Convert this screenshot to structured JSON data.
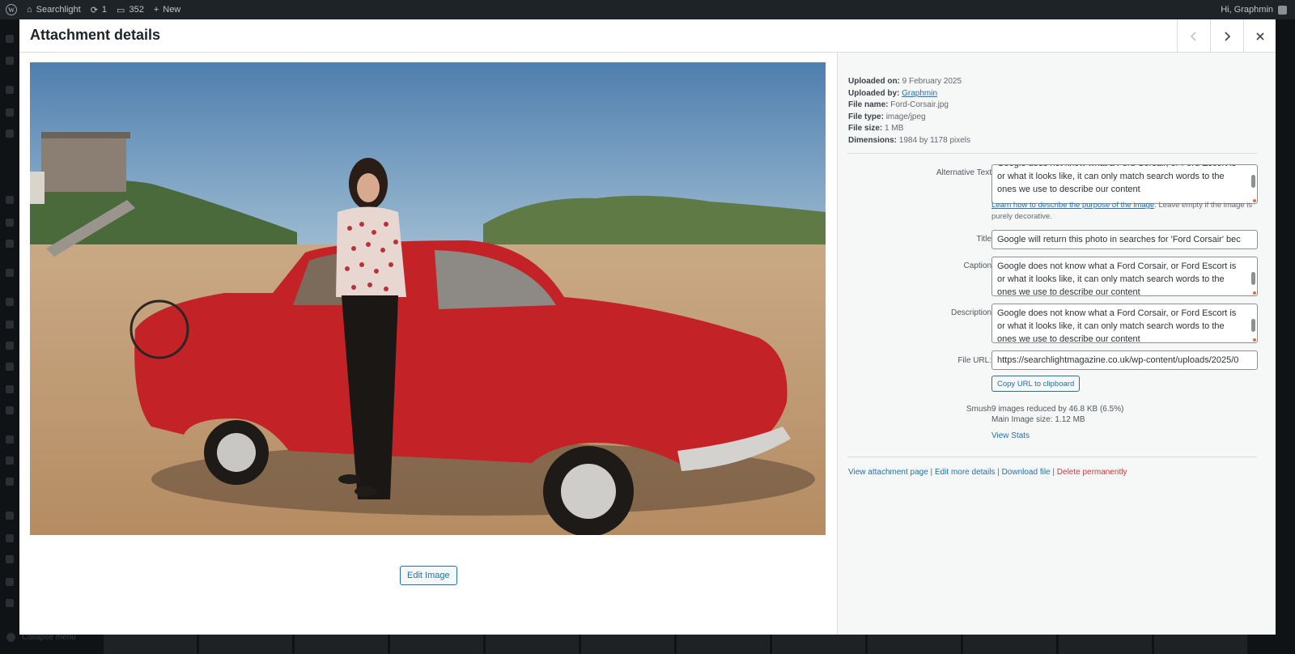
{
  "adminbar": {
    "site_name": "Searchlight",
    "updates": "1",
    "comments": "352",
    "new_label": "New",
    "greeting": "Hi, Graphmin"
  },
  "sidebar_menu": {
    "collapse_label": "Collapse menu"
  },
  "modal": {
    "title": "Attachment details",
    "edit_image_label": "Edit Image"
  },
  "details": {
    "uploaded_on_label": "Uploaded on:",
    "uploaded_on": "9 February 2025",
    "uploaded_by_label": "Uploaded by:",
    "uploaded_by": "Graphmin",
    "file_name_label": "File name:",
    "file_name": "Ford-Corsair.jpg",
    "file_type_label": "File type:",
    "file_type": "image/jpeg",
    "file_size_label": "File size:",
    "file_size": "1 MB",
    "dimensions_label": "Dimensions:",
    "dimensions": "1984 by 1178 pixels"
  },
  "fields": {
    "alt_label": "Alternative Text",
    "alt_value": "Google does not know what a Ford Corsair, or Ford Escort is or what it looks like, it can only match search words to the ones we use to describe our content",
    "alt_help_link": "Learn how to describe the purpose of the image",
    "alt_help_text": ". Leave empty if the image is purely decorative.",
    "title_label": "Title",
    "title_value": "Google will return this photo in searches for 'Ford Corsair' bec",
    "caption_label": "Caption",
    "caption_value": "Google does not know what a Ford Corsair, or Ford Escort is or what it looks like, it can only match search words to the ones we use to describe our content",
    "description_label": "Description",
    "description_value": "Google does not know what a Ford Corsair, or Ford Escort is or what it looks like, it can only match search words to the ones we use to describe our content",
    "url_label": "File URL:",
    "url_value": "https://searchlightmagazine.co.uk/wp-content/uploads/2025/0",
    "copy_label": "Copy URL to clipboard"
  },
  "smush": {
    "label": "Smush",
    "line1": "9 images reduced by 46.8 KB (6.5%)",
    "line2": "Main Image size: 1.12 MB",
    "view_stats": "View Stats"
  },
  "actions": {
    "view_page": "View attachment page",
    "edit_more": "Edit more details",
    "download": "Download file",
    "delete": "Delete permanently",
    "separator": " | "
  }
}
